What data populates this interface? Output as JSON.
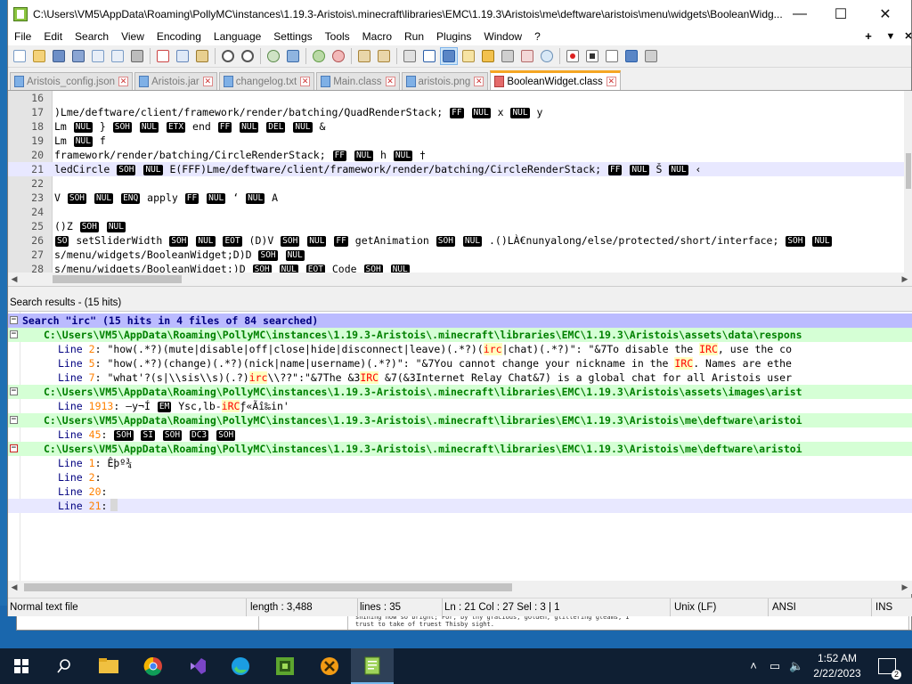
{
  "window": {
    "title": "C:\\Users\\VM5\\AppData\\Roaming\\PollyMC\\instances\\1.19.3-Aristois\\.minecraft\\libraries\\EMC\\1.19.3\\Aristois\\me\\deftware\\aristois\\menu\\widgets\\BooleanWidg...",
    "minimize": "—",
    "maximize": "☐",
    "close": "✕"
  },
  "menu": {
    "items": [
      "File",
      "Edit",
      "Search",
      "View",
      "Encoding",
      "Language",
      "Settings",
      "Tools",
      "Macro",
      "Run",
      "Plugins",
      "Window",
      "?"
    ],
    "plus": "+",
    "dropdown": "▼",
    "close": "✕"
  },
  "toolbar": {
    "icons": [
      "new-file-icon",
      "open-file-icon",
      "save-icon",
      "save-all-icon",
      "close-icon",
      "close-all-icon",
      "print-icon",
      "cut-icon",
      "copy-icon",
      "paste-icon",
      "undo-icon",
      "redo-icon",
      "find-icon",
      "replace-icon",
      "zoom-in-icon",
      "zoom-out-icon",
      "sync-vertical-icon",
      "sync-horizontal-icon",
      "word-wrap-icon",
      "show-all-chars-icon",
      "indent-guide-icon",
      "user-lang-icon",
      "doc-map-icon",
      "function-list-icon",
      "folder-workspace-icon",
      "monitoring-icon",
      "record-macro-icon",
      "stop-macro-icon",
      "play-macro-icon",
      "run-macro-multiple-icon",
      "save-macro-icon"
    ]
  },
  "tabs": [
    {
      "label": "Aristois_config.json",
      "dirty": false,
      "active": false
    },
    {
      "label": "Aristois.jar",
      "dirty": false,
      "active": false
    },
    {
      "label": "changelog.txt",
      "dirty": false,
      "active": false
    },
    {
      "label": "Main.class",
      "dirty": false,
      "active": false
    },
    {
      "label": "aristois.png",
      "dirty": false,
      "active": false
    },
    {
      "label": "BooleanWidget.class",
      "dirty": true,
      "active": true
    }
  ],
  "editor": {
    "lines": [
      {
        "n": "16",
        "text": ""
      },
      {
        "n": "17",
        "text": ")Lme/deftware/client/framework/render/batching/QuadRenderStack; FF NUL x NUL y"
      },
      {
        "n": "18",
        "text": "Lm NUL } SOH NUL ETX end FF NUL DEL NUL &"
      },
      {
        "n": "19",
        "text": "Lm NUL f"
      },
      {
        "n": "20",
        "text": "framework/render/batching/CircleRenderStack; FF NUL h NUL †"
      },
      {
        "n": "21",
        "text": "ledCircle SOH NUL E(FFF)Lme/deftware/client/framework/render/batching/CircleRenderStack; FF NUL Š NUL ‹"
      },
      {
        "n": "22",
        "text": ""
      },
      {
        "n": "23",
        "text": "V SOH NUL ENQ apply FF NUL ‘ NUL A"
      },
      {
        "n": "24",
        "text": ""
      },
      {
        "n": "25",
        "text": "()Z SOH NUL"
      },
      {
        "n": "26",
        "text": "SO setSliderWidth SOH NUL EOT (D)V SOH NUL FF getAnimation SOH NUL .()LÀ€nunyalong/else/protected/short/interface; SOH NUL"
      },
      {
        "n": "27",
        "text": "s/menu/widgets/BooleanWidget;D)D SOH NUL"
      },
      {
        "n": "28",
        "text": "s/menu/widgets/BooleanWidget;)D SOH NUL EOT Code SOH NUL"
      }
    ]
  },
  "search_results": {
    "header": "Search results - (15 hits)",
    "summary_prefix": "Search \"irc\" (15 hits in 4 files of 84 searched)",
    "files": [
      {
        "path": "C:\\Users\\VM5\\AppData\\Roaming\\PollyMC\\instances\\1.19.3-Aristois\\.minecraft\\libraries\\EMC\\1.19.3\\Aristois\\assets\\data\\respons",
        "lines": [
          {
            "label": "Line",
            "num": "2",
            "pre": "   \"how(.*?)(mute|disable|off|close|hide|disconnect|leave)(.*?)(",
            "hit": "irc",
            "post": "|chat)(.*?)\": \"&7To disable the ",
            "hit2": "IRC",
            "post2": ", use the co"
          },
          {
            "label": "Line",
            "num": "5",
            "pre": "   \"how(.*?)(change)(.*?)(nick|name|username)(.*?)\": \"&7You cannot change your nickname in the ",
            "hit": "IRC",
            "post": ". Names are ethe",
            "hit2": "",
            "post2": ""
          },
          {
            "label": "Line",
            "num": "7",
            "pre": "   \"what'?(s|\\\\sis\\\\s)(.?)",
            "hit": "irc",
            "post": "\\\\??\":\"&7The &3",
            "hit2": "IRC",
            "post2": " &7(&3Internet Relay Chat&7) is a global chat for all Aristois user"
          }
        ]
      },
      {
        "path": "C:\\Users\\VM5\\AppData\\Roaming\\PollyMC\\instances\\1.19.3-Aristois\\.minecraft\\libraries\\EMC\\1.19.3\\Aristois\\assets\\images\\arist",
        "lines": [
          {
            "label": "Line",
            "num": "1913",
            "pre": " —y¬Í EM Ysc,lb-",
            "hit": "iRC",
            "post": "ƒ«Ãî‰in'",
            "hit2": "",
            "post2": ""
          }
        ]
      },
      {
        "path": "C:\\Users\\VM5\\AppData\\Roaming\\PollyMC\\instances\\1.19.3-Aristois\\.minecraft\\libraries\\EMC\\1.19.3\\Aristois\\me\\deftware\\aristoi",
        "lines": [
          {
            "label": "Line",
            "num": "45",
            "pre": " SOH SI SOH DC3 SOH",
            "hit": "",
            "post": "",
            "hit2": "",
            "post2": ""
          }
        ]
      },
      {
        "path": "C:\\Users\\VM5\\AppData\\Roaming\\PollyMC\\instances\\1.19.3-Aristois\\.minecraft\\libraries\\EMC\\1.19.3\\Aristois\\me\\deftware\\aristoi",
        "lines": [
          {
            "label": "Line",
            "num": "1",
            "pre": " Êþº¾",
            "hit": "",
            "post": "",
            "hit2": "",
            "post2": ""
          },
          {
            "label": "Line",
            "num": "2",
            "pre": "",
            "hit": "",
            "post": "",
            "hit2": "",
            "post2": ""
          },
          {
            "label": "Line",
            "num": "20",
            "pre": "",
            "hit": "",
            "post": "",
            "hit2": "",
            "post2": ""
          },
          {
            "label": "Line",
            "num": "21",
            "pre": "",
            "hit": "",
            "post": "",
            "hit2": "",
            "post2": ""
          }
        ]
      }
    ]
  },
  "status": {
    "file_type": "Normal text file",
    "length": "length : 3,488",
    "lines": "lines : 35",
    "position": "Ln : 21    Col : 27    Sel : 3 | 1",
    "eol": "Unix (LF)",
    "encoding": "ANSI",
    "mode": "INS"
  },
  "background_window": {
    "text": "shining now so bright; For, by thy gracious, golden, glittering gleams, I trust to take of truest Thisby sight."
  },
  "taskbar": {
    "time": "1:52 AM",
    "date": "2/22/2023",
    "notification_count": "2"
  }
}
